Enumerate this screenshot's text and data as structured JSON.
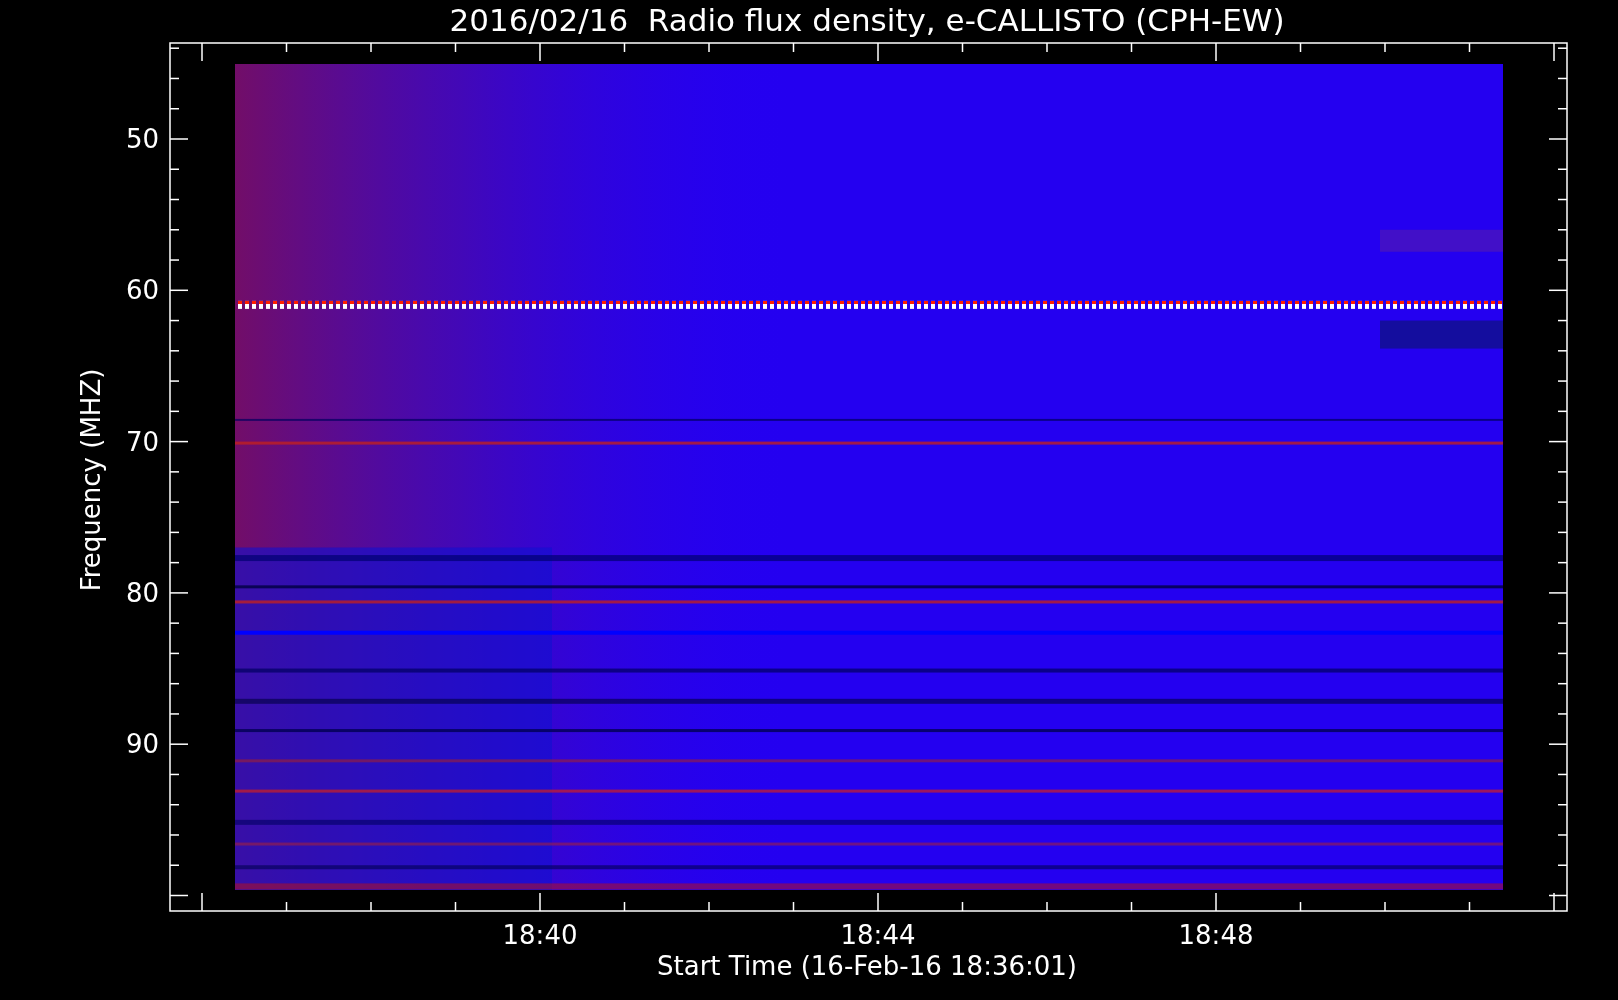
{
  "title": "2016/02/16  Radio flux density, e-CALLISTO (CPH-EW)",
  "y_axis": {
    "label": "Frequency (MHZ)",
    "ticks": [
      "50",
      "60",
      "70",
      "80",
      "90"
    ]
  },
  "x_axis": {
    "label": "Start Time (16-Feb-16 18:36:01)",
    "ticks": [
      "18:40",
      "18:44",
      "18:48"
    ]
  }
}
